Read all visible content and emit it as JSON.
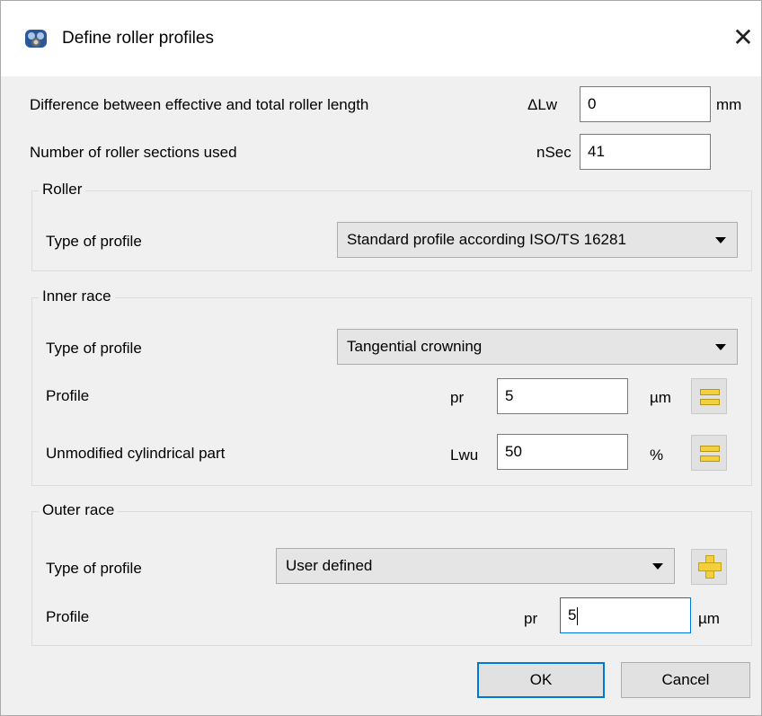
{
  "window": {
    "title": "Define roller profiles",
    "icon": "bearing-app-icon",
    "close_glyph": "✕"
  },
  "general": {
    "length_diff": {
      "label": "Difference between effective and total roller length",
      "symbol": "ΔLw",
      "value": "0",
      "unit": "mm"
    },
    "sections": {
      "label": "Number of roller sections used",
      "symbol": "nSec",
      "value": "41"
    }
  },
  "roller": {
    "group_title": "Roller",
    "type_label": "Type of profile",
    "type_value": "Standard profile according ISO/TS 16281"
  },
  "inner_race": {
    "group_title": "Inner race",
    "type_label": "Type of profile",
    "type_value": "Tangential crowning",
    "profile": {
      "label": "Profile",
      "symbol": "pr",
      "value": "5",
      "unit": "µm",
      "icon": "equal-icon"
    },
    "cylindrical": {
      "label": "Unmodified cylindrical part",
      "symbol": "Lwu",
      "value": "50",
      "unit": "%",
      "icon": "equal-icon"
    }
  },
  "outer_race": {
    "group_title": "Outer race",
    "type_label": "Type of profile",
    "type_value": "User defined",
    "add_icon": "plus-icon",
    "profile": {
      "label": "Profile",
      "symbol": "pr",
      "value": "5",
      "unit": "µm"
    }
  },
  "buttons": {
    "ok": "OK",
    "cancel": "Cancel"
  },
  "colors": {
    "focus": "#0078d7",
    "icon_yellow": "#f2d040"
  }
}
